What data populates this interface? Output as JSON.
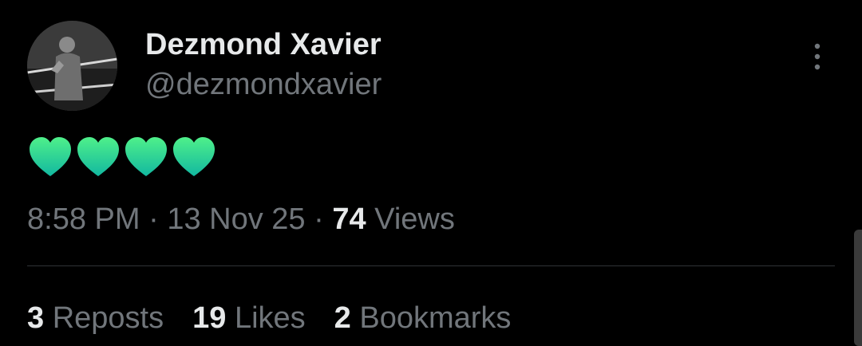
{
  "author": {
    "display_name": "Dezmond Xavier",
    "handle": "@dezmondxavier"
  },
  "post": {
    "emoji_text": "💚💚💚💚",
    "emoji_icon": "green-heart-icon",
    "emoji_count": 4,
    "emoji_color": "#2ecf8f"
  },
  "meta": {
    "time": "8:58 PM",
    "separator": "·",
    "date": "13 Nov 25",
    "views_count": "74",
    "views_label": "Views"
  },
  "stats": {
    "reposts_count": "3",
    "reposts_label": "Reposts",
    "likes_count": "19",
    "likes_label": "Likes",
    "bookmarks_count": "2",
    "bookmarks_label": "Bookmarks"
  },
  "colors": {
    "background": "#000000",
    "primary_text": "#e7e9ea",
    "secondary_text": "#71767b",
    "divider": "#2f3336"
  }
}
